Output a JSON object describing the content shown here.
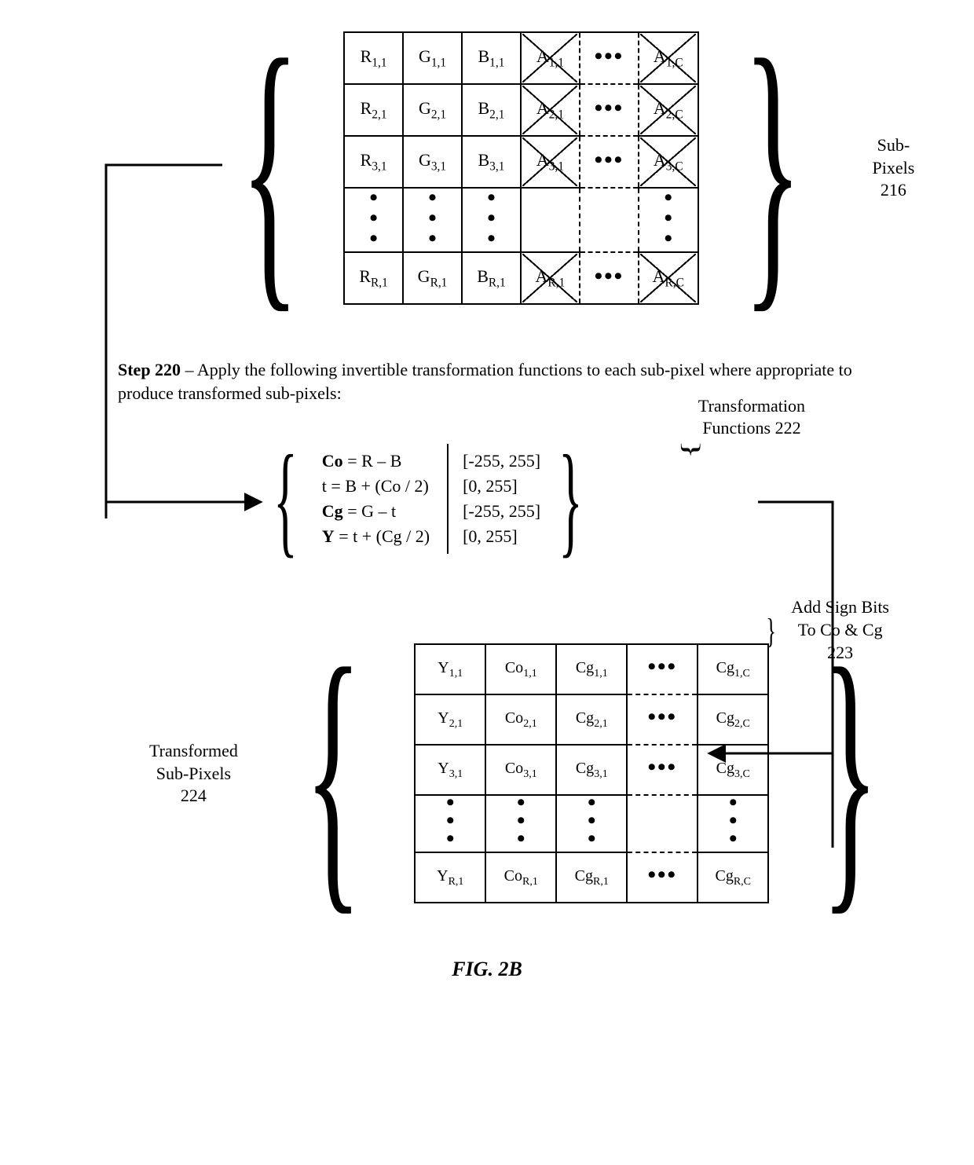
{
  "figure_id": "FIG. 2B",
  "subpixels_label": {
    "line1": "Sub-Pixels",
    "line2": "216"
  },
  "transformed_label": {
    "line1": "Transformed",
    "line2": "Sub-Pixels",
    "line3": "224"
  },
  "tf_label": {
    "line1": "Transformation",
    "line2": "Functions 222"
  },
  "signbits_label": {
    "line1": "Add Sign Bits",
    "line2": "To Co & Cg",
    "line3": "223"
  },
  "step": {
    "bold": "Step 220",
    "rest": " – Apply the following invertible transformation functions to each sub-pixel where appropriate to produce transformed sub-pixels:"
  },
  "equations": [
    {
      "lhs_bold": "Co",
      "rhs": " = R – B",
      "range": "[-255, 255]"
    },
    {
      "lhs": "t = B + (Co / 2)",
      "range": "[0, 255]"
    },
    {
      "lhs_bold": "Cg",
      "rhs": " = G – t",
      "range": "[-255, 255]"
    },
    {
      "lhs_bold": "Y",
      "rhs": " = t + (Cg / 2)",
      "range": "[0, 255]"
    }
  ],
  "grid_top": {
    "rows": [
      [
        {
          "t": "R",
          "s": "1,1"
        },
        {
          "t": "G",
          "s": "1,1"
        },
        {
          "t": "B",
          "s": "1,1"
        },
        {
          "t": "A",
          "s": "1,1",
          "x": true
        },
        {
          "dots": "h"
        },
        {
          "t": "A",
          "s": "1,C",
          "x": true
        }
      ],
      [
        {
          "t": "R",
          "s": "2,1"
        },
        {
          "t": "G",
          "s": "2,1"
        },
        {
          "t": "B",
          "s": "2,1"
        },
        {
          "t": "A",
          "s": "2,1",
          "x": true
        },
        {
          "dots": "h"
        },
        {
          "t": "A",
          "s": "2,C",
          "x": true
        }
      ],
      [
        {
          "t": "R",
          "s": "3,1"
        },
        {
          "t": "G",
          "s": "3,1"
        },
        {
          "t": "B",
          "s": "3,1"
        },
        {
          "t": "A",
          "s": "3,1",
          "x": true
        },
        {
          "dots": "h"
        },
        {
          "t": "A",
          "s": "3,C",
          "x": true
        }
      ],
      [
        {
          "dots": "v"
        },
        {
          "dots": "v"
        },
        {
          "dots": "v"
        },
        {
          "blank": true
        },
        {
          "blank": true
        },
        {
          "dots": "v"
        }
      ],
      [
        {
          "t": "R",
          "s": "R,1"
        },
        {
          "t": "G",
          "s": "R,1"
        },
        {
          "t": "B",
          "s": "R,1"
        },
        {
          "t": "A",
          "s": "R,1",
          "x": true
        },
        {
          "dots": "h"
        },
        {
          "t": "A",
          "s": "R,C",
          "x": true
        }
      ]
    ]
  },
  "grid_bottom": {
    "rows": [
      [
        {
          "t": "Y",
          "s": "1,1"
        },
        {
          "t": "Co",
          "s": "1,1"
        },
        {
          "t": "Cg",
          "s": "1,1"
        },
        {
          "dots": "h"
        },
        {
          "t": "Cg",
          "s": "1,C"
        }
      ],
      [
        {
          "t": "Y",
          "s": "2,1"
        },
        {
          "t": "Co",
          "s": "2,1"
        },
        {
          "t": "Cg",
          "s": "2,1"
        },
        {
          "dots": "h"
        },
        {
          "t": "Cg",
          "s": "2,C"
        }
      ],
      [
        {
          "t": "Y",
          "s": "3,1"
        },
        {
          "t": "Co",
          "s": "3,1"
        },
        {
          "t": "Cg",
          "s": "3,1"
        },
        {
          "dots": "h"
        },
        {
          "t": "Cg",
          "s": "3,C"
        }
      ],
      [
        {
          "dots": "v"
        },
        {
          "dots": "v"
        },
        {
          "dots": "v"
        },
        {
          "blank": true
        },
        {
          "dots": "v"
        }
      ],
      [
        {
          "t": "Y",
          "s": "R,1"
        },
        {
          "t": "Co",
          "s": "R,1"
        },
        {
          "t": "Cg",
          "s": "R,1"
        },
        {
          "dots": "h"
        },
        {
          "t": "Cg",
          "s": "R,C"
        }
      ]
    ]
  }
}
